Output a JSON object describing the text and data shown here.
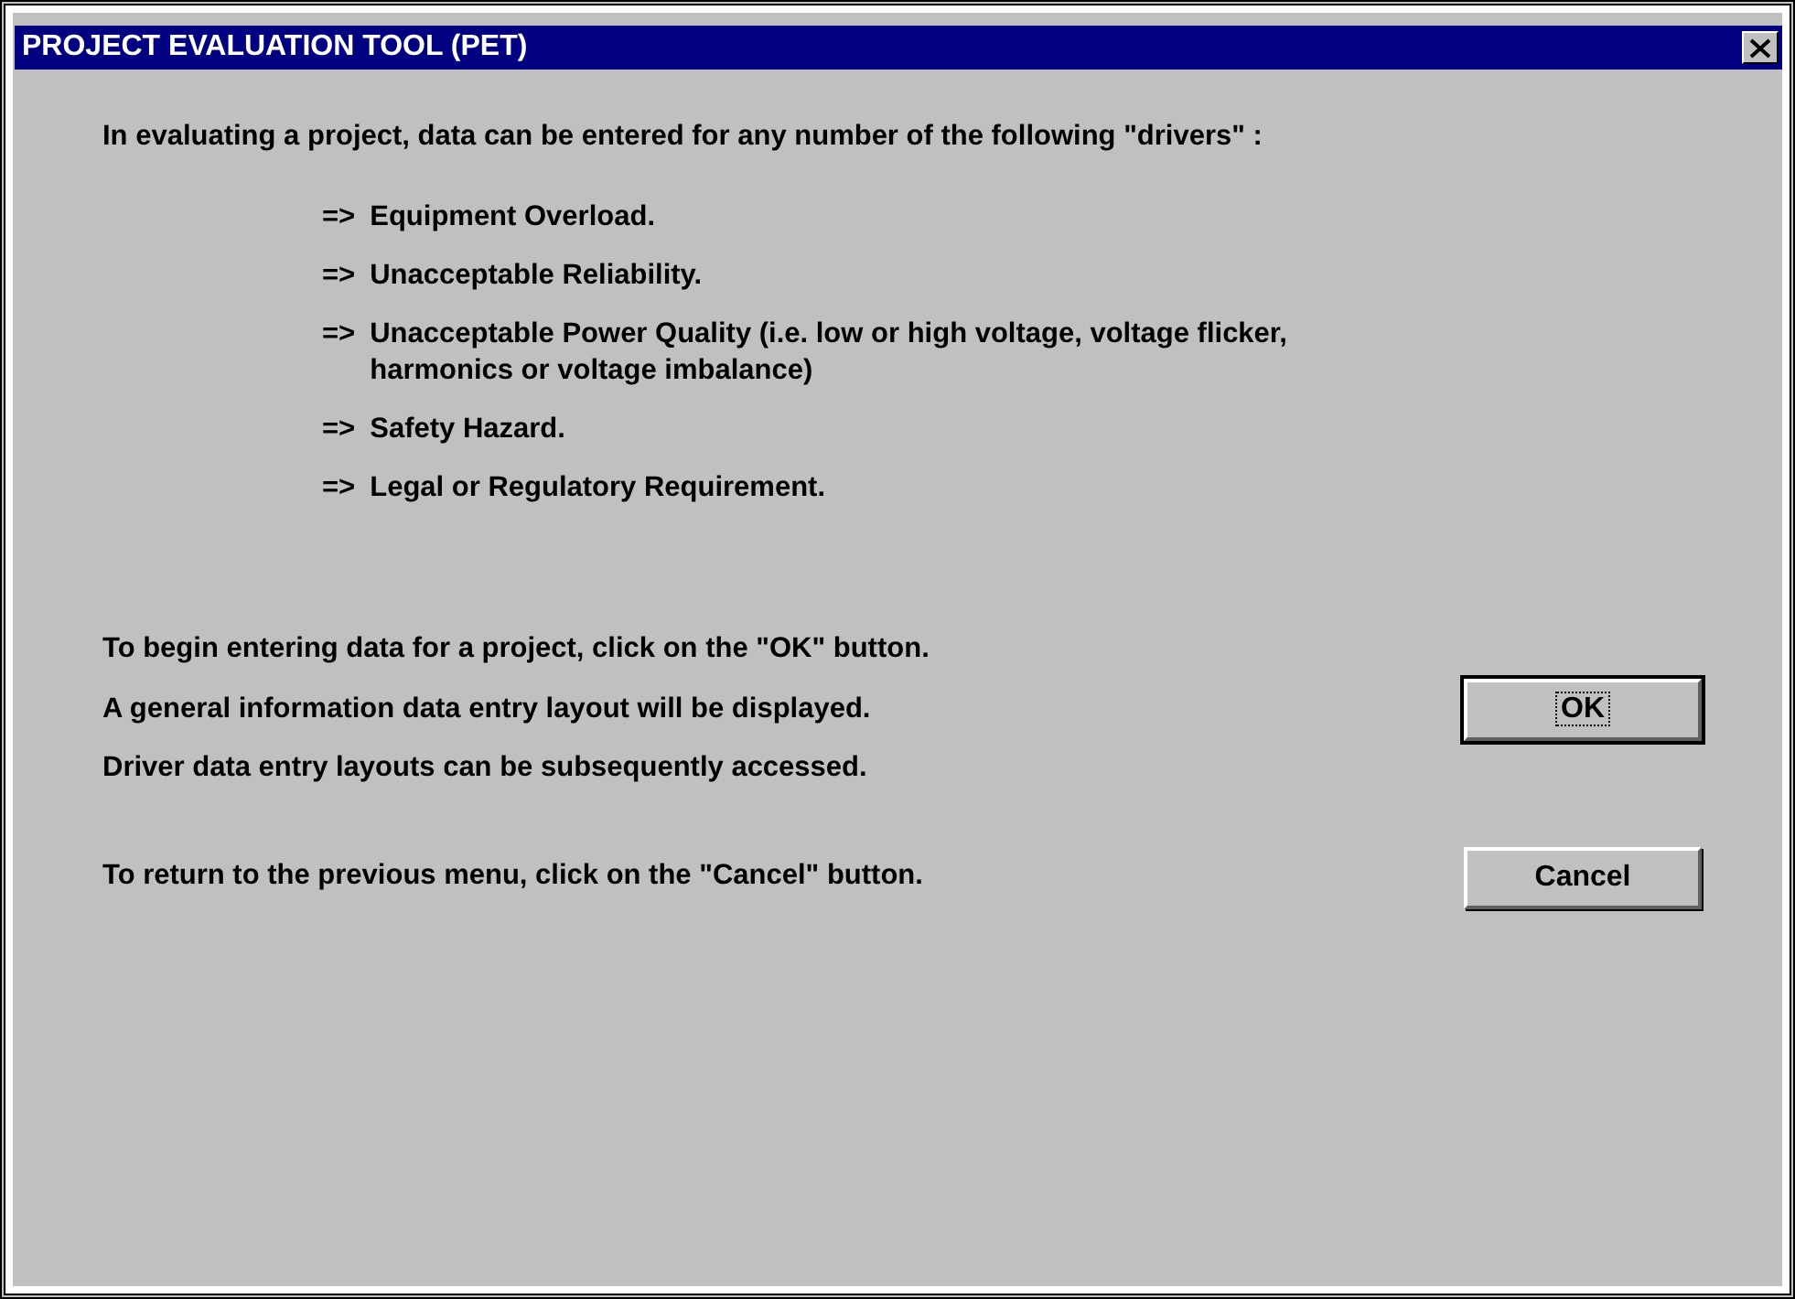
{
  "window": {
    "title": "PROJECT EVALUATION TOOL (PET)"
  },
  "intro": "In evaluating a project, data can be entered for any number of the following \"drivers\" :",
  "drivers": [
    {
      "marker": "=>",
      "text": "Equipment Overload."
    },
    {
      "marker": "=>",
      "text": "Unacceptable Reliability."
    },
    {
      "marker": "=>",
      "text": "Unacceptable Power Quality (i.e. low or high voltage, voltage flicker, harmonics or voltage imbalance)"
    },
    {
      "marker": "=>",
      "text": "Safety Hazard."
    },
    {
      "marker": "=>",
      "text": "Legal or Regulatory Requirement."
    }
  ],
  "ok_section": {
    "lines": [
      "To begin entering data for a project, click on the \"OK\" button.",
      "A general information data entry layout will be displayed.",
      "Driver data entry layouts can be subsequently accessed."
    ],
    "button": {
      "label": "OK",
      "focused": true
    }
  },
  "cancel_section": {
    "lines": [
      "To return to the previous menu, click on the \"Cancel\" button."
    ],
    "button": {
      "label": "Cancel",
      "focused": false
    }
  }
}
